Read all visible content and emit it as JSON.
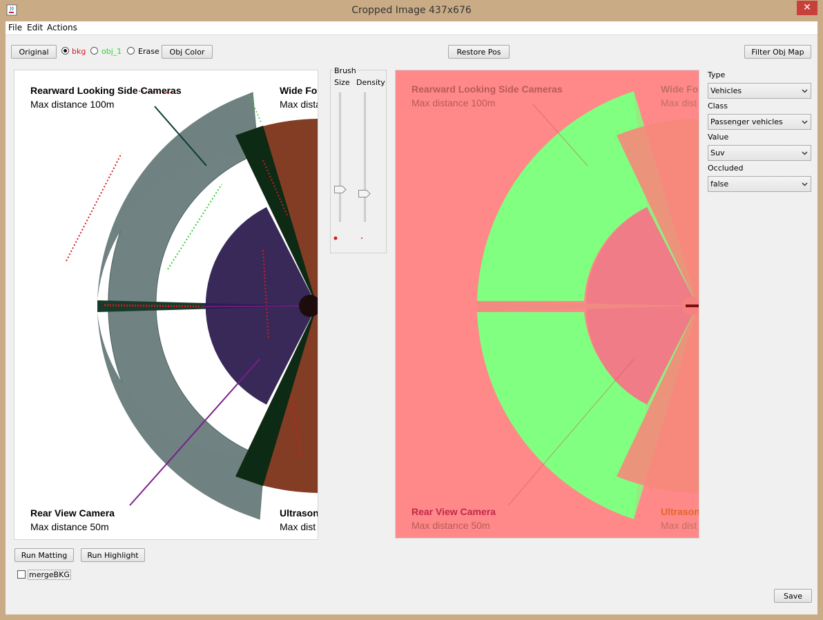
{
  "window": {
    "title": "Cropped Image  437x676",
    "close_glyph": "✕"
  },
  "menu": [
    "File",
    "Edit",
    "Actions"
  ],
  "toolbar": {
    "original": "Original",
    "radio_bkg": "bkg",
    "radio_obj1": "obj_1",
    "radio_erase": "Erase",
    "obj_color": "Obj Color",
    "restore_pos": "Restore Pos",
    "filter_obj_map": "Filter Obj Map",
    "selected_mode": "bkg"
  },
  "brush": {
    "title": "Brush",
    "size_label": "Size",
    "density_label": "Density",
    "size_level": 0.25,
    "density_level": 0.22
  },
  "image_left": {
    "top_left_title": "Rearward Looking Side Cameras",
    "top_left_sub": "Max distance 100m",
    "top_right_title": "Wide Fo",
    "top_right_sub": "Max dista",
    "bottom_left_title": "Rear View Camera",
    "bottom_left_sub": "Max distance 50m",
    "bottom_right_title": "Ultrason",
    "bottom_right_sub": "Max dist"
  },
  "image_right": {
    "top_left_title": "Rearward Looking Side Cameras",
    "top_left_sub": "Max distance 100m",
    "top_right_title": "Wide Fo",
    "top_right_sub": "Max dist",
    "bottom_left_title": "Rear View Camera",
    "bottom_left_sub": "Max distance 50m",
    "bottom_right_title": "Ultrason",
    "bottom_right_sub": "Max dist"
  },
  "attributes": {
    "type_label": "Type",
    "type_value": "Vehicles",
    "class_label": "Class",
    "class_value": "Passenger vehicles",
    "value_label": "Value",
    "value_value": "Suv",
    "occluded_label": "Occluded",
    "occluded_value": "false"
  },
  "bottom": {
    "run_matting": "Run Matting",
    "run_highlight": "Run Highlight",
    "merge_bkg": "mergeBKG",
    "merge_bkg_checked": false,
    "save": "Save"
  },
  "colors": {
    "bkg_label": "#d8181e",
    "obj1_label": "#2ed12e",
    "mask_background": "#ff8888",
    "mask_object": "#80ff80"
  },
  "icons": {
    "app": "java-cup-icon",
    "dropdown": "chevron-down-icon",
    "close": "close-icon"
  }
}
